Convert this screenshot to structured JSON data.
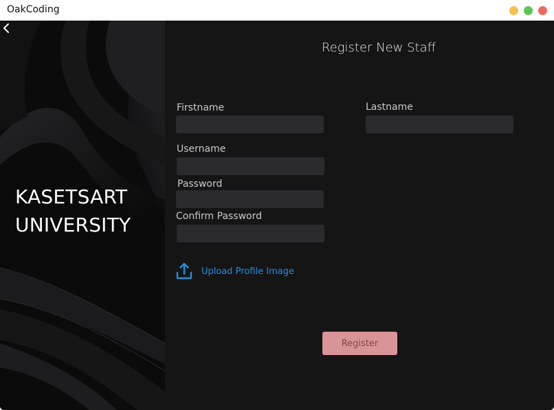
{
  "app": {
    "title": "OakCoding",
    "window_controls": {
      "minimize_color": "#f5be4f",
      "maximize_color": "#5ec554",
      "close_color": "#ee6a5f"
    }
  },
  "left_panel": {
    "back_icon": "chevron-left-icon",
    "university_line1": "KASETSART",
    "university_line2": "UNIVERSITY"
  },
  "form": {
    "title": "Register New Staff",
    "fields": {
      "firstname": {
        "label": "Firstname",
        "value": ""
      },
      "lastname": {
        "label": "Lastname",
        "value": ""
      },
      "username": {
        "label": "Username",
        "value": ""
      },
      "password": {
        "label": "Password",
        "value": ""
      },
      "confirm_password": {
        "label": "Confirm Password",
        "value": ""
      }
    },
    "upload": {
      "icon": "upload-icon",
      "label": "Upload Profile Image"
    },
    "register_label": "Register"
  },
  "colors": {
    "background": "#151516",
    "input_background": "#2a2a2f",
    "link": "#1e90e0",
    "register_button": "#d99497"
  }
}
